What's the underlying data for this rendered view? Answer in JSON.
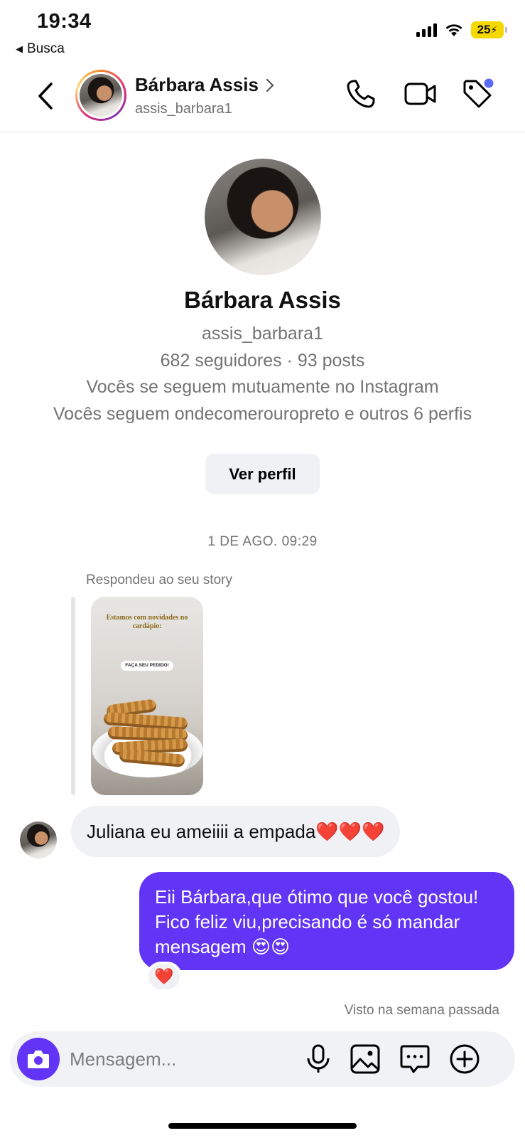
{
  "status_bar": {
    "time": "19:34",
    "back_app": "Busca",
    "battery": "25",
    "battery_color": "#f5d800"
  },
  "header": {
    "name": "Bárbara Assis",
    "username": "assis_barbara1",
    "icons": [
      "back-arrow-icon",
      "chevron-right-icon",
      "phone-icon",
      "video-camera-icon",
      "tag-icon"
    ]
  },
  "profile": {
    "name": "Bárbara Assis",
    "username": "assis_barbara1",
    "stats": "682 seguidores · 93 posts",
    "mutual": "Vocês se seguem mutuamente no Instagram",
    "following": "Vocês seguem ondecomerouropreto e outros 6 perfis",
    "view_button": "Ver perfil"
  },
  "thread": {
    "date_separator": "1 DE AGO. 09:29",
    "reply_note": "Respondeu ao seu story",
    "story": {
      "headline": "Estamos com novidades no cardápio:",
      "sticker": "FAÇA SEU PEDIDO!"
    },
    "incoming_message": "Juliana eu ameiiii a empada❤️❤️❤️",
    "outgoing_message": "Eii Bárbara,que ótimo que você gostou! Fico feliz viu,precisando é só mandar mensagem 😍😍",
    "reaction": "❤️",
    "seen": "Visto na semana passada"
  },
  "composer": {
    "placeholder": "Mensagem...",
    "icons": [
      "camera-icon",
      "microphone-icon",
      "gallery-icon",
      "sticker-chat-icon",
      "plus-icon"
    ],
    "accent": "#6234f5"
  }
}
